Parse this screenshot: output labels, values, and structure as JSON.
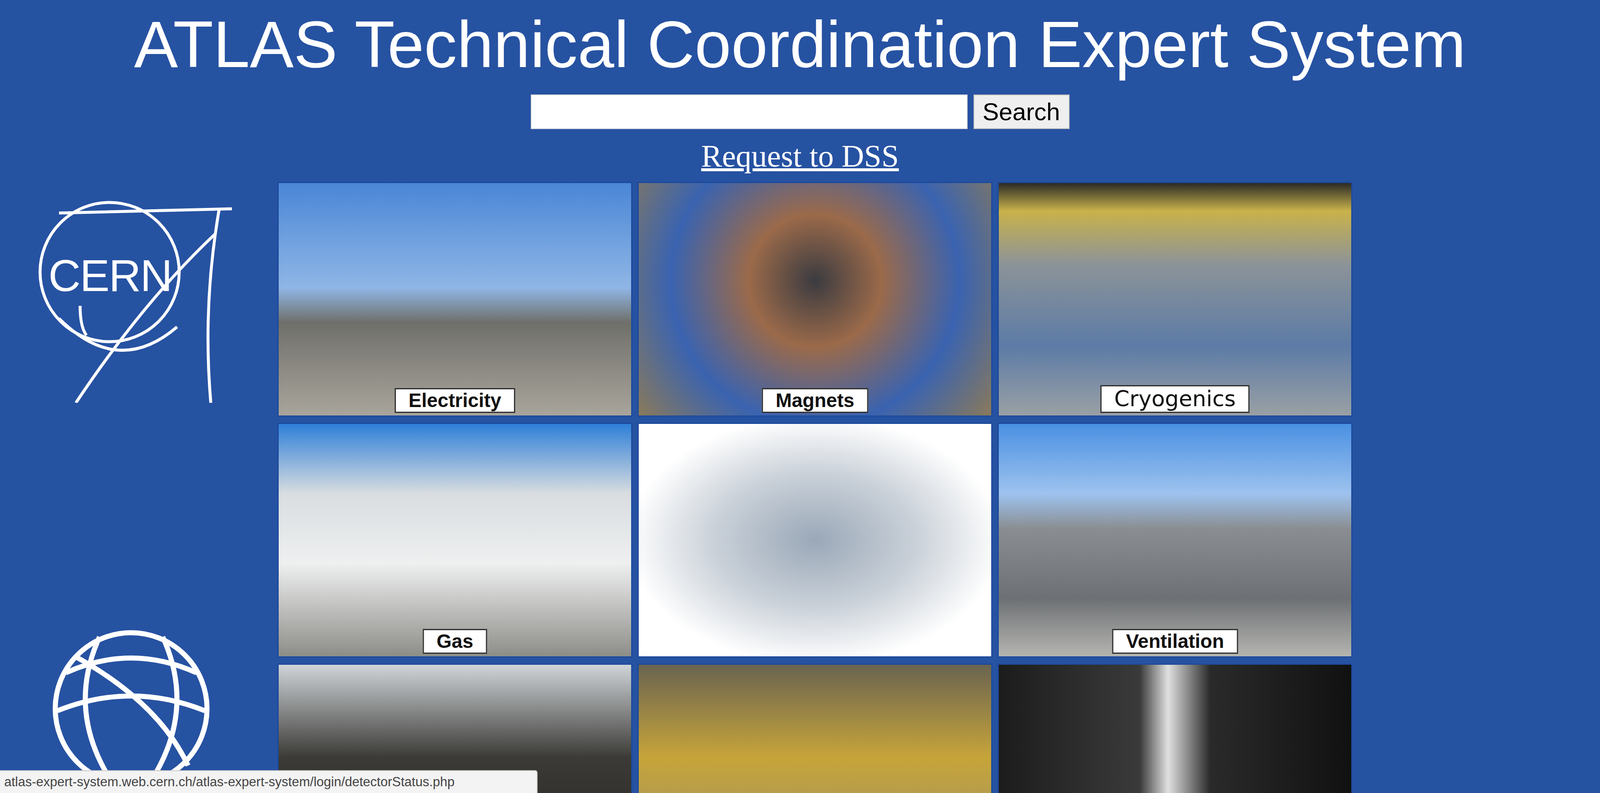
{
  "page": {
    "title": "ATLAS Technical Coordination Expert System"
  },
  "search": {
    "value": "",
    "button": "Search"
  },
  "link": "Request to DSS",
  "logo": {
    "text": "CERN"
  },
  "tiles": [
    {
      "label": "Electricity"
    },
    {
      "label": "Magnets"
    },
    {
      "label": "Cryogenics"
    },
    {
      "label": "Gas"
    },
    {
      "label": ""
    },
    {
      "label": "Ventilation"
    },
    {
      "label": ""
    },
    {
      "label": ""
    },
    {
      "label": ""
    }
  ],
  "status_bar": "atlas-expert-system.web.cern.ch/atlas-expert-system/login/detectorStatus.php"
}
